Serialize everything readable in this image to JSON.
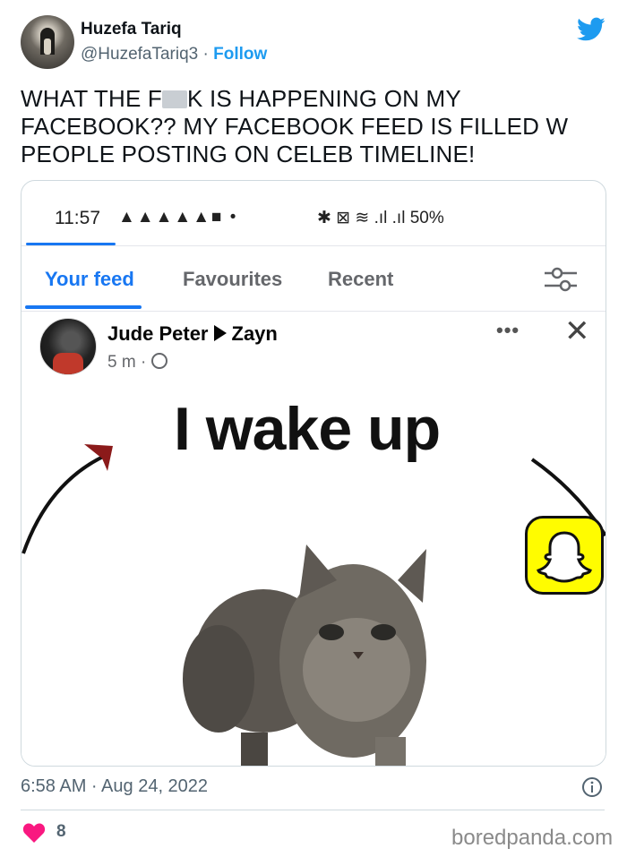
{
  "tweet": {
    "author_name": "Huzefa Tariq",
    "handle": "@HuzefaTariq3",
    "separator": "·",
    "follow_label": "Follow",
    "text_before_blur": "WHAT THE F",
    "text_after_blur": "K IS HAPPENING ON MY FACEBOOK?? MY FACEBOOK FEED IS FILLED W PEOPLE POSTING ON CELEB TIMELINE!",
    "timestamp": "6:58 AM · Aug 24, 2022",
    "likes_count": "8"
  },
  "screenshot": {
    "status_time": "11:57",
    "status_icons": "▲▲▲▲▲■ •",
    "status_right": "✱ ⊠ ≋ .ıl .ıl 50%",
    "tabs": [
      {
        "label": "Your feed",
        "active": true
      },
      {
        "label": "Favourites",
        "active": false
      },
      {
        "label": "Recent",
        "active": false
      }
    ],
    "post": {
      "author": "Jude Peter",
      "target": "Zayn",
      "time": "5 m ·",
      "more_label": "•••",
      "close_label": "✕"
    },
    "meme_caption": "I wake up"
  },
  "watermark": "boredpanda.com",
  "colors": {
    "twitter_blue": "#1d9bf0",
    "facebook_blue": "#1877f2",
    "heart_pink": "#f91880",
    "snap_yellow": "#fffc00"
  },
  "icons": [
    "twitter-bird-icon",
    "filter-icon",
    "globe-icon",
    "snapchat-icon",
    "info-icon",
    "heart-icon"
  ]
}
